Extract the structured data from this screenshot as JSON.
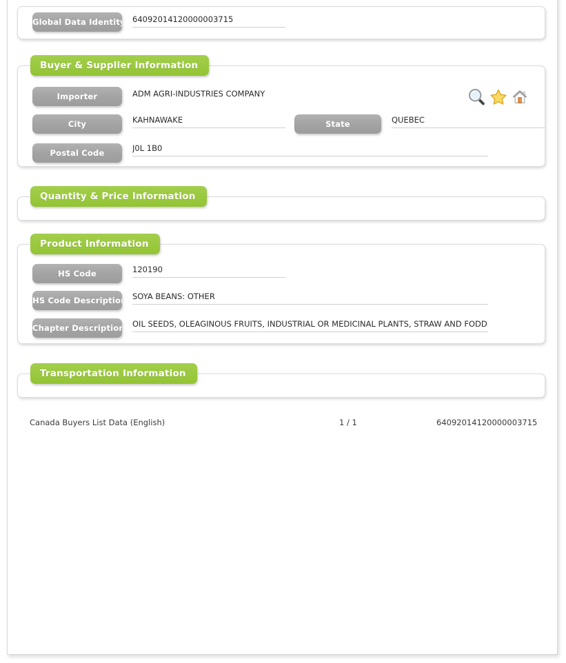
{
  "page": {
    "sections": [
      {
        "id": "global-data-identity",
        "fields": [
          {
            "label": "Global Data Identity",
            "value": "64092014120000003715"
          }
        ]
      },
      {
        "id": "buyer-supplier-information",
        "legend": "Buyer & Supplier Information",
        "fields": [
          {
            "label": "Importer",
            "value": "ADM AGRI-INDUSTRIES COMPANY"
          },
          {
            "label": "City",
            "value": "KAHNAWAKE"
          },
          {
            "label": "State",
            "value": "QUEBEC"
          },
          {
            "label": "Postal Code",
            "value": "J0L 1B0"
          }
        ]
      },
      {
        "id": "quantity-price-information",
        "legend": "Quantity & Price Information",
        "fields": []
      },
      {
        "id": "product-information",
        "legend": "Product Information",
        "fields": [
          {
            "label": "HS Code",
            "value": "120190"
          },
          {
            "label": "HS Code Description",
            "value": "SOYA BEANS: OTHER"
          },
          {
            "label": "Chapter Description",
            "value": "OIL SEEDS, OLEAGINOUS FRUITS, INDUSTRIAL OR MEDICINAL PLANTS, STRAW AND FODDER"
          }
        ]
      },
      {
        "id": "transportation-information",
        "legend": "Transportation Information",
        "fields": []
      }
    ]
  },
  "toolbar": {
    "icons": [
      {
        "name": "search-icon",
        "title": "Search"
      },
      {
        "name": "star-icon",
        "title": "Favorite"
      },
      {
        "name": "home-icon",
        "title": "Home"
      }
    ]
  },
  "footer": {
    "source": "Canada Buyers List Data (English)",
    "page_indicator": "1 / 1",
    "record_id": "64092014120000003715"
  },
  "colors": {
    "legend_green": "#9bc93c",
    "pill_grey": "#a9a9a9",
    "underline": "#cfcfcf",
    "text": "#2b2b2b"
  }
}
